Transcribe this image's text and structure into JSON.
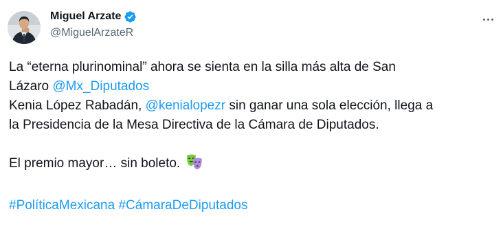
{
  "author": {
    "display_name": "Miguel Arzate",
    "handle": "@MiguelArzateR",
    "verified": true,
    "avatar_icon": "profile-photo"
  },
  "menu": {
    "icon": "more-horizontal-icon"
  },
  "tweet": {
    "l1": "La “eterna plurinominal” ahora se sienta en la silla más alta de San",
    "l2_text": "Lázaro ",
    "mention_1": "@Mx_Diputados",
    "l3_text_a": "Kenia López Rabadán, ",
    "mention_2": "@kenialopezr",
    "l3_text_b": " sin ganar una sola elección, llega a",
    "l4": "la Presidencia de la Mesa Directiva de la Cámara de Diputados.",
    "l5": "El premio mayor… sin boleto. ",
    "emoji": "performing-arts-icon",
    "hashtag_1": "#PolíticaMexicana",
    "hashtag_2": "#CámaraDeDiputados"
  },
  "colors": {
    "link": "#1d9bf0",
    "text": "#0f1419",
    "secondary": "#536471",
    "verified": "#1d9bf0"
  }
}
